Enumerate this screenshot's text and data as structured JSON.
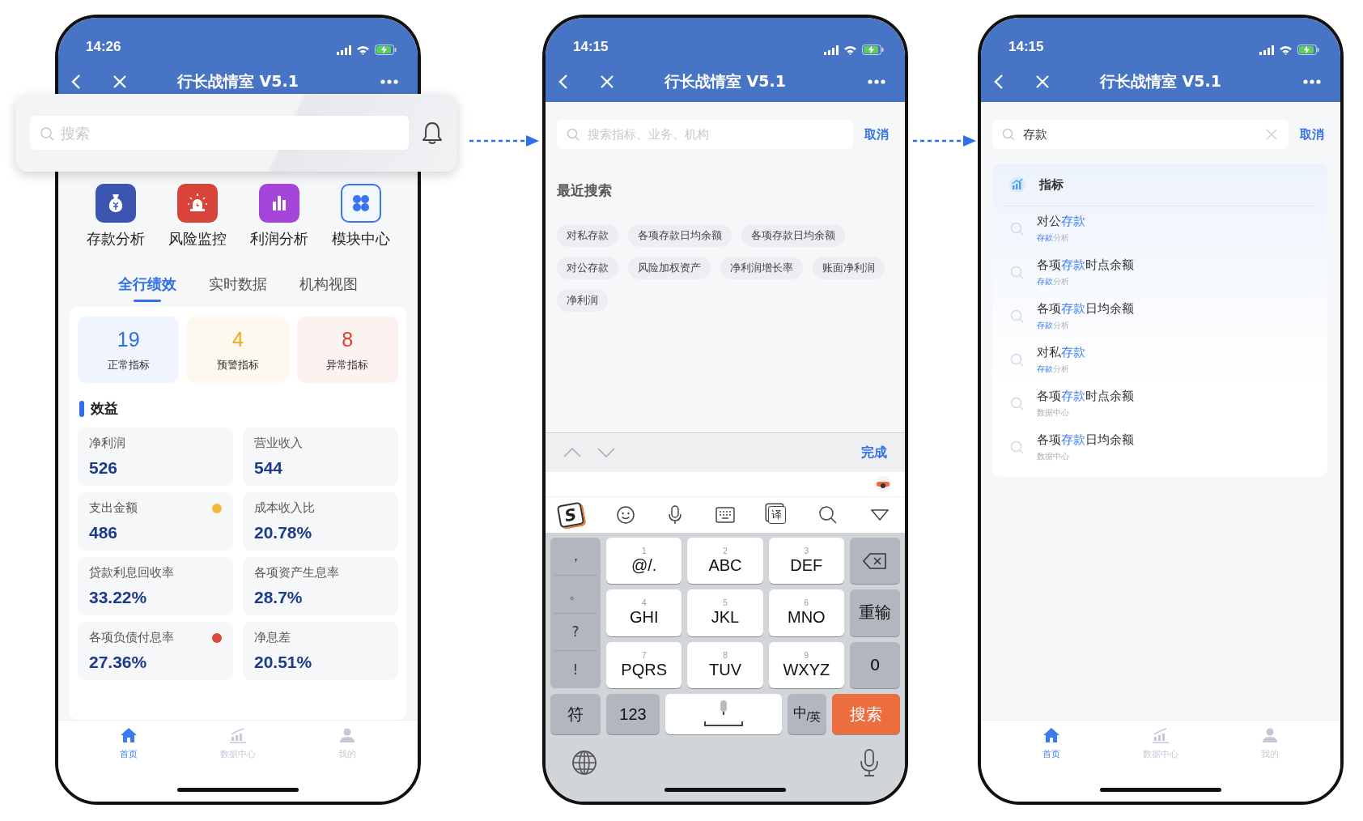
{
  "screens": [
    {
      "kind": "home",
      "time": "14:26",
      "title": "行长战情室 V5.1",
      "search": {
        "placeholder": "搜索"
      },
      "shortcuts": [
        {
          "label": "存款分析",
          "kind": "filled",
          "color": "#3a56b0"
        },
        {
          "label": "风险监控",
          "kind": "filled",
          "color": "#d9443a"
        },
        {
          "label": "利润分析",
          "kind": "filled",
          "color": "#a444d8"
        },
        {
          "label": "模块中心",
          "kind": "outlined",
          "color": "#3b74ee"
        }
      ],
      "tabs": [
        {
          "label": "全行绩效",
          "selected": true
        },
        {
          "label": "实时数据",
          "selected": false
        },
        {
          "label": "机构视图",
          "selected": false
        }
      ],
      "summary": [
        {
          "value": "19",
          "label": "正常指标",
          "color": "#2f6fe0"
        },
        {
          "value": "4",
          "label": "预警指标",
          "color": "#f2a516"
        },
        {
          "value": "8",
          "label": "异常指标",
          "color": "#d9432f"
        }
      ],
      "section_title": "效益",
      "metrics": [
        {
          "label": "净利润",
          "value": "526"
        },
        {
          "label": "营业收入",
          "value": "544"
        },
        {
          "label": "支出金额",
          "value": "486",
          "color": "#f5b93a"
        },
        {
          "label": "成本收入比",
          "value": "20.78%"
        },
        {
          "label": "贷款利息回收率",
          "value": "33.22%"
        },
        {
          "label": "各项资产生息率",
          "value": "28.7%"
        },
        {
          "label": "各项负债付息率",
          "value": "27.36%",
          "color": "#e04a3a"
        },
        {
          "label": "净息差",
          "value": "20.51%"
        }
      ],
      "tab_bar": [
        {
          "label": "首页",
          "selected": true
        },
        {
          "label": "数据中心",
          "selected": false
        },
        {
          "label": "我的",
          "selected": false
        }
      ]
    },
    {
      "kind": "recent_search",
      "time": "14:15",
      "title": "行长战情室 V5.1",
      "search": {
        "placeholder": "搜索指标、业务、机构"
      },
      "cancel": "取消",
      "recent_title": "最近搜索",
      "recent": [
        "对私存款",
        "各项存款日均余额",
        "各项存款日均余额",
        "对公存款",
        "风险加权资产",
        "净利润增长率",
        "账面净利润",
        "净利润"
      ],
      "keyboard": {
        "done": "完成",
        "ime_logo": "S",
        "translate_glyph": "译",
        "punctuation": [
          "，",
          "。",
          "?",
          "!"
        ],
        "keys": [
          {
            "digit": "1",
            "letters": "@/."
          },
          {
            "digit": "2",
            "letters": "ABC"
          },
          {
            "digit": "3",
            "letters": "DEF"
          },
          {
            "digit": "4",
            "letters": "GHI"
          },
          {
            "digit": "5",
            "letters": "JKL"
          },
          {
            "digit": "6",
            "letters": "MNO"
          },
          {
            "digit": "7",
            "letters": "PQRS"
          },
          {
            "digit": "8",
            "letters": "TUV"
          },
          {
            "digit": "9",
            "letters": "WXYZ"
          }
        ],
        "side_keys": [
          {
            "kind": "delete"
          },
          {
            "kind": "text",
            "label": "重输"
          },
          {
            "kind": "text",
            "label": "0"
          }
        ],
        "bottom_keys": [
          {
            "kind": "gray",
            "label": "符"
          },
          {
            "kind": "gray",
            "label": "123"
          },
          {
            "kind": "space"
          },
          {
            "kind": "gray",
            "label": "中$_{/英}$"
          },
          {
            "kind": "action",
            "label": "搜索"
          }
        ]
      }
    },
    {
      "kind": "search_results",
      "time": "14:15",
      "title": "行长战情室 V5.1",
      "search": {
        "value": "存款"
      },
      "cancel": "取消",
      "results": {
        "title": "指标",
        "items": [
          {
            "title": [
              {
                "text": "对公",
                "hit": false
              },
              {
                "text": "存款",
                "hit": true
              }
            ],
            "source": [
              {
                "text": "存款",
                "hit": true
              },
              {
                "text": "分析",
                "hit": false
              }
            ]
          },
          {
            "title": [
              {
                "text": "各项",
                "hit": false
              },
              {
                "text": "存款",
                "hit": true
              },
              {
                "text": "时点余额",
                "hit": false
              }
            ],
            "source": [
              {
                "text": "存款",
                "hit": true
              },
              {
                "text": "分析",
                "hit": false
              }
            ]
          },
          {
            "title": [
              {
                "text": "各项",
                "hit": false
              },
              {
                "text": "存款",
                "hit": true
              },
              {
                "text": "日均余额",
                "hit": false
              }
            ],
            "source": [
              {
                "text": "存款",
                "hit": true
              },
              {
                "text": "分析",
                "hit": false
              }
            ]
          },
          {
            "title": [
              {
                "text": "对私",
                "hit": false
              },
              {
                "text": "存款",
                "hit": true
              }
            ],
            "source": [
              {
                "text": "存款",
                "hit": true
              },
              {
                "text": "分析",
                "hit": false
              }
            ]
          },
          {
            "title": [
              {
                "text": "各项",
                "hit": false
              },
              {
                "text": "存款",
                "hit": true
              },
              {
                "text": "时点余额",
                "hit": false
              }
            ],
            "source": [
              {
                "text": "数据中心",
                "hit": false
              }
            ]
          },
          {
            "title": [
              {
                "text": "各项",
                "hit": false
              },
              {
                "text": "存款",
                "hit": true
              },
              {
                "text": "日均余额",
                "hit": false
              }
            ],
            "source": [
              {
                "text": "数据中心",
                "hit": false
              }
            ]
          }
        ]
      },
      "tab_bar": [
        {
          "label": "首页",
          "selected": true
        },
        {
          "label": "数据中心",
          "selected": false
        },
        {
          "label": "我的",
          "selected": false
        }
      ]
    }
  ]
}
